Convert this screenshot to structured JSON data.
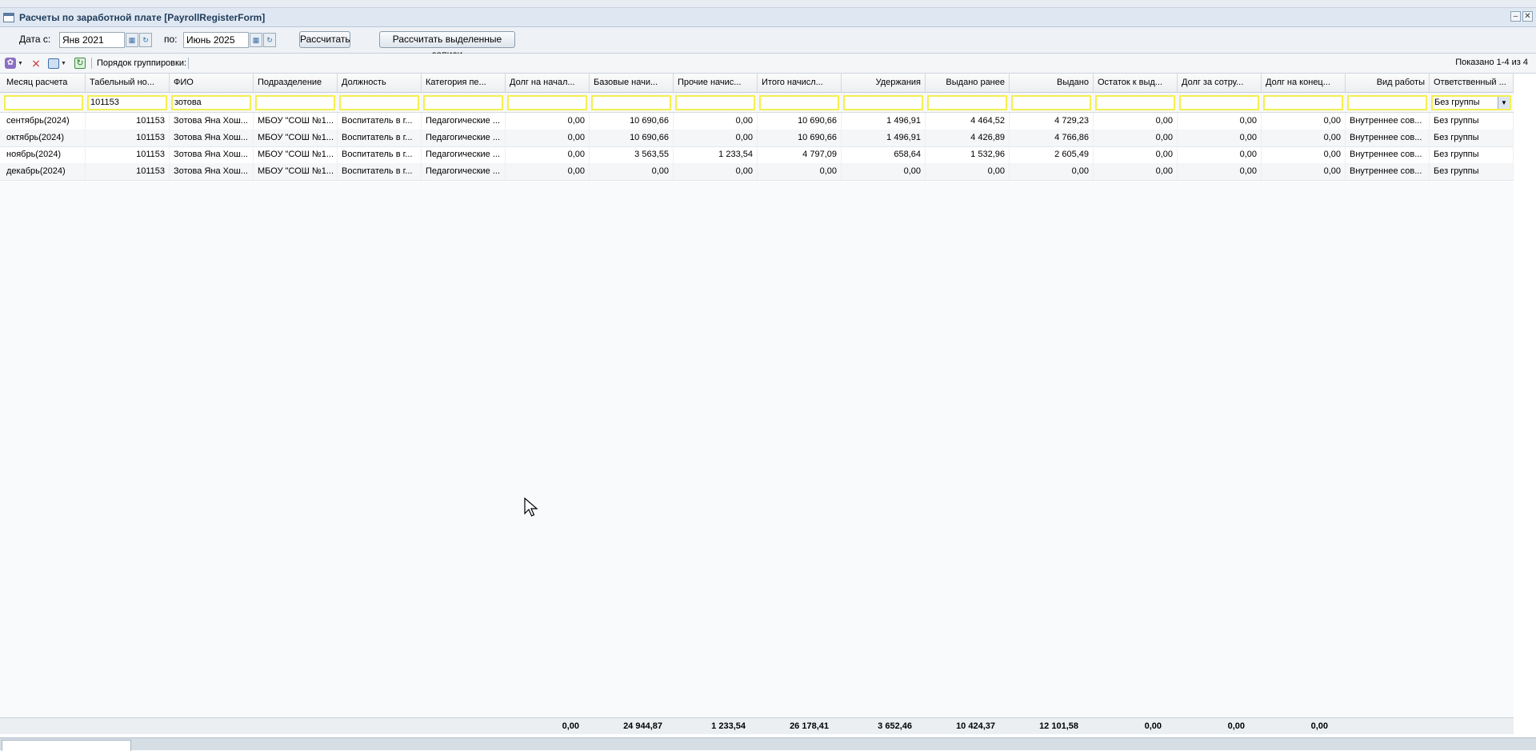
{
  "window": {
    "title": "Расчеты по заработной плате [PayrollRegisterForm]"
  },
  "datebar": {
    "from_label": "Дата с:",
    "from_value": "Янв 2021",
    "to_label": "по:",
    "to_value": "Июнь 2025",
    "calc_button": "Рассчитать",
    "calc_selected_button": "Рассчитать выделенные записи"
  },
  "toolbar": {
    "grouping_label": "Порядок группировки:",
    "shown_text": "Показано 1-4 из 4"
  },
  "columns": [
    "Месяц расчета",
    "Табельный но...",
    "ФИО",
    "Подразделение",
    "Должность",
    "Категория пе...",
    "Долг на начал...",
    "Базовые начи...",
    "Прочие начис...",
    "Итого начисл...",
    "Удержания",
    "Выдано ранее",
    "Выдано",
    "Остаток к выд...",
    "Долг за сотру...",
    "Долг на конец...",
    "Вид работы",
    "Ответственный ..."
  ],
  "filters": {
    "tab_number": "101153",
    "fio": "зотова",
    "responsible": "Без группы"
  },
  "rows": [
    [
      "сентябрь(2024)",
      "101153",
      "Зотова Яна Хош...",
      "МБОУ \"СОШ №1...",
      "Воспитатель в г...",
      "Педагогические ...",
      "0,00",
      "10 690,66",
      "0,00",
      "10 690,66",
      "1 496,91",
      "4 464,52",
      "4 729,23",
      "0,00",
      "0,00",
      "0,00",
      "Внутреннее сов...",
      "Без группы"
    ],
    [
      "октябрь(2024)",
      "101153",
      "Зотова Яна Хош...",
      "МБОУ \"СОШ №1...",
      "Воспитатель в г...",
      "Педагогические ...",
      "0,00",
      "10 690,66",
      "0,00",
      "10 690,66",
      "1 496,91",
      "4 426,89",
      "4 766,86",
      "0,00",
      "0,00",
      "0,00",
      "Внутреннее сов...",
      "Без группы"
    ],
    [
      "ноябрь(2024)",
      "101153",
      "Зотова Яна Хош...",
      "МБОУ \"СОШ №1...",
      "Воспитатель в г...",
      "Педагогические ...",
      "0,00",
      "3 563,55",
      "1 233,54",
      "4 797,09",
      "658,64",
      "1 532,96",
      "2 605,49",
      "0,00",
      "0,00",
      "0,00",
      "Внутреннее сов...",
      "Без группы"
    ],
    [
      "декабрь(2024)",
      "101153",
      "Зотова Яна Хош...",
      "МБОУ \"СОШ №1...",
      "Воспитатель в г...",
      "Педагогические ...",
      "0,00",
      "0,00",
      "0,00",
      "0,00",
      "0,00",
      "0,00",
      "0,00",
      "0,00",
      "0,00",
      "0,00",
      "Внутреннее сов...",
      "Без группы"
    ]
  ],
  "totals": [
    "0,00",
    "24 944,87",
    "1 233,54",
    "26 178,41",
    "3 652,46",
    "10 424,37",
    "12 101,58",
    "0,00",
    "0,00",
    "0,00"
  ]
}
